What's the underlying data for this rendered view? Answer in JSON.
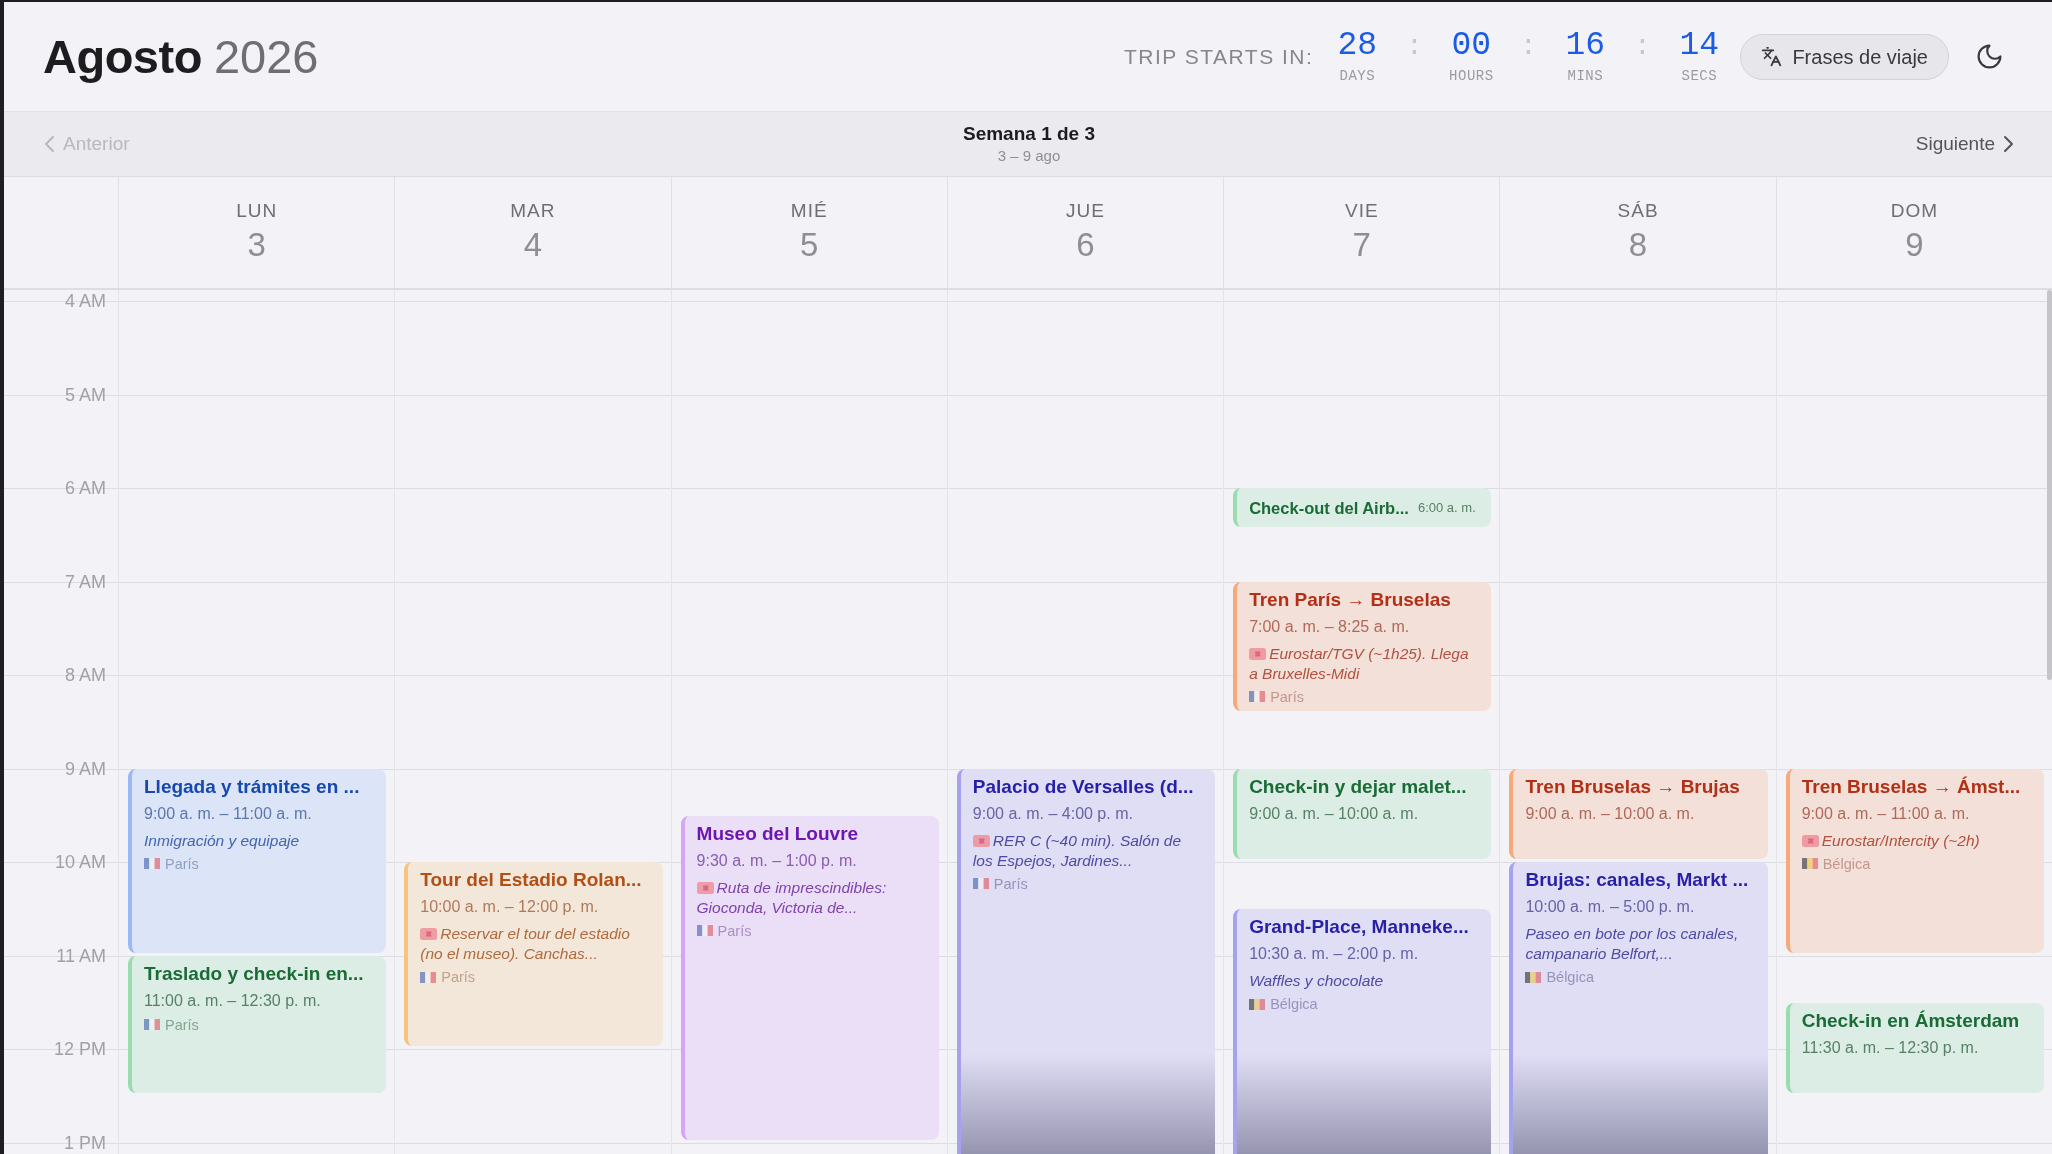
{
  "header": {
    "month": "Agosto",
    "year": "2026",
    "countdown": {
      "label": "TRIP STARTS IN:",
      "units": [
        {
          "value": "28",
          "unit": "DAYS"
        },
        {
          "value": "00",
          "unit": "HOURS"
        },
        {
          "value": "16",
          "unit": "MINS"
        },
        {
          "value": "14",
          "unit": "SECS"
        }
      ],
      "separators": [
        ":",
        ":",
        ":"
      ]
    },
    "phrases_button": {
      "label": "Frases de viaje"
    }
  },
  "week_nav": {
    "previous": {
      "label": "Anterior",
      "disabled": true
    },
    "title": "Semana 1 de 3",
    "range": "3 – 9 ago",
    "next": {
      "label": "Siguiente",
      "disabled": false
    }
  },
  "hours": [
    "4 AM",
    "5 AM",
    "6 AM",
    "7 AM",
    "8 AM",
    "9 AM",
    "10 AM",
    "11 AM",
    "12 PM",
    "1 PM"
  ],
  "days": [
    {
      "name": "LUN",
      "number": "3",
      "events": [
        {
          "kind": "block",
          "title": "Llegada y trámites en ...",
          "time": "9:00 a. m. – 11:00 a. m.",
          "note": {
            "text": "Inmigración y equipaje",
            "ticket": false
          },
          "location": {
            "text": "París",
            "kind": "france"
          },
          "color": "#9bb8f5"
        },
        {
          "kind": "block",
          "title": "Traslado y check-in en...",
          "time": "11:00 a. m. – 12:30 p. m.",
          "location": {
            "text": "París",
            "kind": "france"
          },
          "color": "#98dcb0"
        }
      ]
    },
    {
      "name": "MAR",
      "number": "4",
      "events": [
        {
          "kind": "block",
          "title": "Tour del Estadio Rolan...",
          "time": "10:00 a. m. – 12:00 p. m.",
          "note": {
            "text": "Reservar el tour del estadio (no el museo). Canchas...",
            "ticket": true
          },
          "location": {
            "text": "París",
            "kind": "france"
          },
          "color": "#f6c47d"
        }
      ]
    },
    {
      "name": "MIÉ",
      "number": "5",
      "events": [
        {
          "kind": "block",
          "title": "Museo del Louvre",
          "time": "9:30 a. m. – 1:00 p. m.",
          "note": {
            "text": "Ruta de imprescindibles: Gioconda, Victoria de...",
            "ticket": true
          },
          "location": {
            "text": "París",
            "kind": "france"
          },
          "color": "#d3a6f6"
        }
      ]
    },
    {
      "name": "JUE",
      "number": "6",
      "events": [
        {
          "kind": "block",
          "title": "Palacio de Versalles (d...",
          "time": "9:00 a. m. – 4:00 p. m.",
          "note": {
            "text": "RER C (~40 min). Salón de los Espejos, Jardines...",
            "ticket": true
          },
          "location": {
            "text": "París",
            "kind": "france"
          },
          "color": "#a6a2ee"
        }
      ]
    },
    {
      "name": "VIE",
      "number": "7",
      "events": [
        {
          "kind": "compact",
          "title": "Check-out del Airb...",
          "time": "6:00 a. m.",
          "color": "#98dcb0"
        },
        {
          "kind": "block",
          "title": "Tren París → Bruselas",
          "time": "7:00 a. m. – 8:25 a. m.",
          "note": {
            "text": "Eurostar/TGV (~1h25). Llega a Bruxelles-Midi",
            "ticket": true
          },
          "location": {
            "text": "París",
            "kind": "france"
          },
          "color": "#f6a979"
        },
        {
          "kind": "block",
          "title": "Check-in y dejar malet...",
          "time": "9:00 a. m. – 10:00 a. m.",
          "color": "#98dcb0"
        },
        {
          "kind": "block",
          "title": "Grand-Place, Manneke...",
          "time": "10:30 a. m. – 2:00 p. m.",
          "note": {
            "text": "Waffles y chocolate",
            "ticket": false
          },
          "location": {
            "text": "Bélgica",
            "kind": "belgium"
          },
          "color": "#a6a2ee"
        }
      ]
    },
    {
      "name": "SÁB",
      "number": "8",
      "events": [
        {
          "kind": "block",
          "title": "Tren Bruselas → Brujas",
          "time": "9:00 a. m. – 10:00 a. m.",
          "color": "#f6a979"
        },
        {
          "kind": "block",
          "title": "Brujas: canales, Markt ...",
          "time": "10:00 a. m. – 5:00 p. m.",
          "note": {
            "text": "Paseo en bote por los canales, campanario Belfort,...",
            "ticket": false
          },
          "location": {
            "text": "Bélgica",
            "kind": "belgium"
          },
          "color": "#a6a2ee"
        }
      ]
    },
    {
      "name": "DOM",
      "number": "9",
      "events": [
        {
          "kind": "block",
          "title": "Tren Bruselas → Ámst...",
          "time": "9:00 a. m. – 11:00 a. m.",
          "note": {
            "text": "Eurostar/Intercity (~2h)",
            "ticket": true
          },
          "location": {
            "text": "Bélgica",
            "kind": "belgium"
          },
          "color": "#f6a979"
        },
        {
          "kind": "block",
          "title": "Check-in en Ámsterdam",
          "time": "11:30 a. m. – 12:30 p. m.",
          "color": "#98dcb0"
        }
      ]
    }
  ]
}
